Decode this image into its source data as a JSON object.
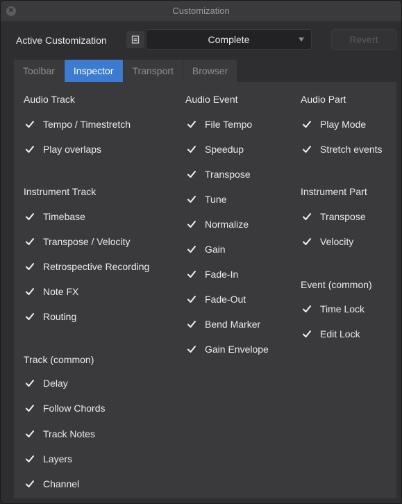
{
  "window": {
    "title": "Customization"
  },
  "toolbar": {
    "active_label": "Active Customization",
    "doc_icon": "document-icon",
    "selected": "Complete",
    "revert_label": "Revert"
  },
  "tabs": [
    {
      "label": "Toolbar",
      "active": false
    },
    {
      "label": "Inspector",
      "active": true
    },
    {
      "label": "Transport",
      "active": false
    },
    {
      "label": "Browser",
      "active": false
    }
  ],
  "columns": {
    "col1": {
      "audio_track": {
        "heading": "Audio Track",
        "items": [
          {
            "label": "Tempo / Timestretch",
            "checked": true
          },
          {
            "label": "Play overlaps",
            "checked": true
          }
        ]
      },
      "instrument_track": {
        "heading": "Instrument Track",
        "items": [
          {
            "label": "Timebase",
            "checked": true
          },
          {
            "label": "Transpose / Velocity",
            "checked": true
          },
          {
            "label": "Retrospective Recording",
            "checked": true
          },
          {
            "label": "Note FX",
            "checked": true
          },
          {
            "label": "Routing",
            "checked": true
          }
        ]
      },
      "track_common": {
        "heading": "Track (common)",
        "items": [
          {
            "label": "Delay",
            "checked": true
          },
          {
            "label": "Follow Chords",
            "checked": true
          },
          {
            "label": "Track Notes",
            "checked": true
          },
          {
            "label": "Layers",
            "checked": true
          },
          {
            "label": "Channel",
            "checked": true
          }
        ]
      }
    },
    "col2": {
      "audio_event": {
        "heading": "Audio Event",
        "items": [
          {
            "label": "File Tempo",
            "checked": true
          },
          {
            "label": "Speedup",
            "checked": true
          },
          {
            "label": "Transpose",
            "checked": true
          },
          {
            "label": "Tune",
            "checked": true
          },
          {
            "label": "Normalize",
            "checked": true
          },
          {
            "label": "Gain",
            "checked": true
          },
          {
            "label": "Fade-In",
            "checked": true
          },
          {
            "label": "Fade-Out",
            "checked": true
          },
          {
            "label": "Bend Marker",
            "checked": true
          },
          {
            "label": "Gain Envelope",
            "checked": true
          }
        ]
      }
    },
    "col3": {
      "audio_part": {
        "heading": "Audio Part",
        "items": [
          {
            "label": "Play Mode",
            "checked": true
          },
          {
            "label": "Stretch events",
            "checked": true
          }
        ]
      },
      "instrument_part": {
        "heading": "Instrument Part",
        "items": [
          {
            "label": "Transpose",
            "checked": true
          },
          {
            "label": "Velocity",
            "checked": true
          }
        ]
      },
      "event_common": {
        "heading": "Event (common)",
        "items": [
          {
            "label": "Time Lock",
            "checked": true
          },
          {
            "label": "Edit Lock",
            "checked": true
          }
        ]
      }
    }
  }
}
